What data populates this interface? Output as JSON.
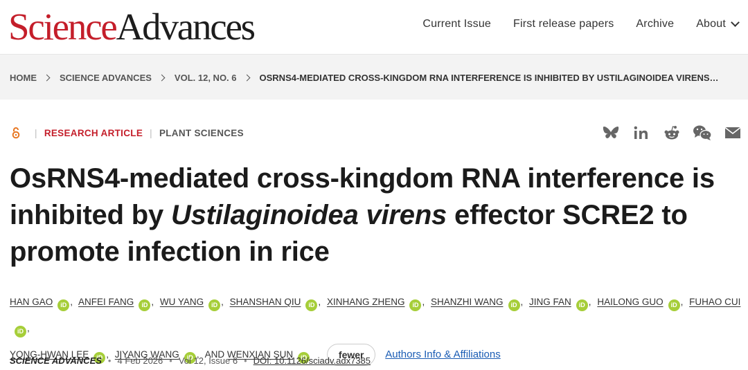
{
  "header": {
    "logo_science": "Science",
    "logo_advances": "Advances",
    "nav": [
      "Current Issue",
      "First release papers",
      "Archive",
      "About"
    ]
  },
  "breadcrumb": [
    "HOME",
    "SCIENCE ADVANCES",
    "VOL. 12, NO. 6",
    "OSRNS4-MEDIATED CROSS-KINGDOM RNA INTERFERENCE IS INHIBITED BY USTILAGINOIDEA VIRENS…"
  ],
  "article": {
    "type": "RESEARCH ARTICLE",
    "subject": "PLANT SCIENCES",
    "title_part1": "OsRNS4-mediated cross-kingdom RNA interference is inhibited by ",
    "title_italic": "Ustilaginoidea virens",
    "title_part2": " effector SCRE2 to promote infection in rice"
  },
  "authors": [
    "HAN GAO",
    "ANFEI FANG",
    "WU YANG",
    "SHANSHAN QIU",
    "XINHANG ZHENG",
    "SHANZHI WANG",
    "JING FAN",
    "HAILONG GUO",
    "FUHAO CUI",
    "YONG-HWAN LEE",
    "JIYANG WANG",
    "WENXIAN SUN"
  ],
  "authors_and": "AND",
  "orcid_label": "iD",
  "fewer_label": "fewer",
  "affiliations_link": "Authors Info & Affiliations",
  "publication": {
    "journal": "SCIENCE ADVANCES",
    "date": "4 Feb 2026",
    "volume": "Vol 12, Issue 6",
    "doi": "DOI: 10.1126/sciadv.adx7385"
  },
  "share_icons": [
    "bluesky-icon",
    "linkedin-icon",
    "reddit-icon",
    "wechat-icon",
    "email-icon"
  ],
  "colors": {
    "brand_red": "#c41e2a",
    "orcid_green": "#a6ce39",
    "link_blue": "#1a5cb4",
    "open_access_orange": "#e87722"
  }
}
